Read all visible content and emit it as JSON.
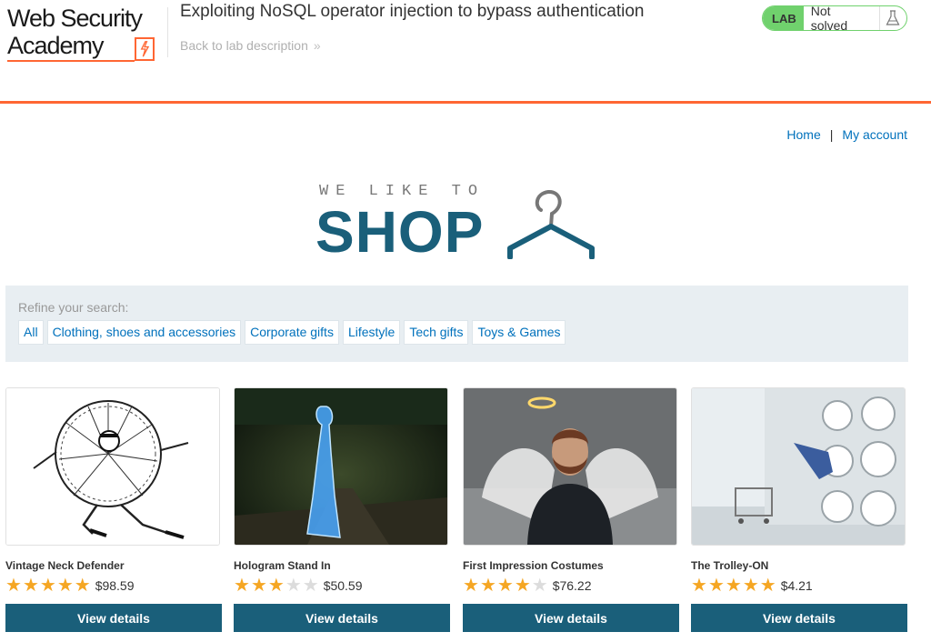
{
  "academy": {
    "logo_line1": "Web Security",
    "logo_line2": "Academy",
    "lab_title": "Exploiting NoSQL operator injection to bypass authentication",
    "back_link": "Back to lab description",
    "lab_badge": "LAB",
    "lab_status": "Not solved",
    "colors": {
      "accent": "#ff6633",
      "status_green": "#70d16d"
    }
  },
  "nav": {
    "home": "Home",
    "separator": "|",
    "my_account": "My account"
  },
  "banner": {
    "line1": "WE LIKE TO",
    "line2": "SHOP",
    "icon": "hanger-icon"
  },
  "filter": {
    "label": "Refine your search:",
    "categories": [
      "All",
      "Clothing, shoes and accessories",
      "Corporate gifts",
      "Lifestyle",
      "Tech gifts",
      "Toys & Games"
    ]
  },
  "products": [
    {
      "name": "Vintage Neck Defender",
      "rating": 5,
      "max_rating": 5,
      "price": "$98.59",
      "button": "View details",
      "image": "illustration-of-man-in-giant-ruff"
    },
    {
      "name": "Hologram Stand In",
      "rating": 3,
      "max_rating": 5,
      "price": "$50.59",
      "button": "View details",
      "image": "blue-hologram-woman-in-park"
    },
    {
      "name": "First Impression Costumes",
      "rating": 4,
      "max_rating": 5,
      "price": "$76.22",
      "button": "View details",
      "image": "bearded-man-with-angel-wings-and-halo"
    },
    {
      "name": "The Trolley-ON",
      "rating": 5,
      "max_rating": 5,
      "price": "$4.21",
      "button": "View details",
      "image": "person-diving-into-laundromat-dryer"
    }
  ],
  "colors": {
    "brand_blue": "#1a5f7a",
    "link_blue": "#0071bc",
    "star": "#f5a623",
    "filter_bg": "#e8eef2"
  }
}
